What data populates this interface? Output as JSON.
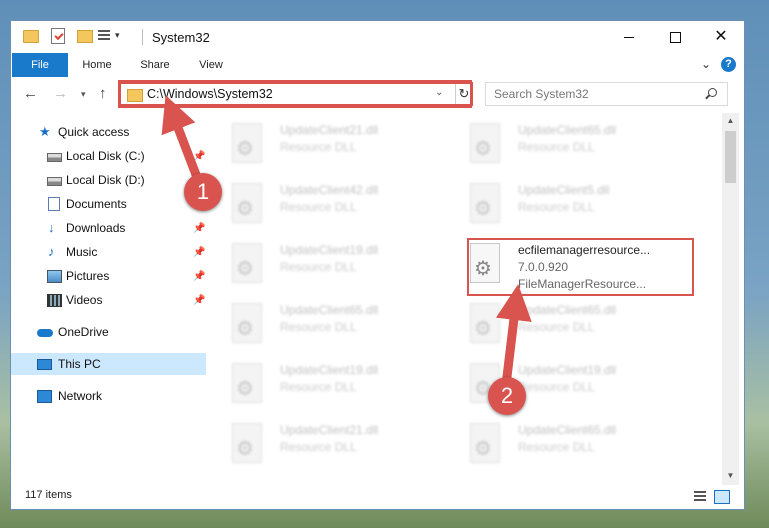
{
  "window": {
    "title": "System32"
  },
  "ribbon": {
    "tabs": [
      "File",
      "Home",
      "Share",
      "View"
    ]
  },
  "address": {
    "path": "C:\\Windows\\System32"
  },
  "search": {
    "placeholder": "Search System32"
  },
  "sidebar": {
    "items": [
      {
        "label": "Quick access",
        "icon": "star-icon",
        "pinned": false
      },
      {
        "label": "Local Disk (C:)",
        "icon": "drive-icon",
        "pinned": true
      },
      {
        "label": "Local Disk (D:)",
        "icon": "drive-icon",
        "pinned": false
      },
      {
        "label": "Documents",
        "icon": "documents-icon",
        "pinned": true
      },
      {
        "label": "Downloads",
        "icon": "download-icon",
        "pinned": true
      },
      {
        "label": "Music",
        "icon": "music-icon",
        "pinned": true
      },
      {
        "label": "Pictures",
        "icon": "pictures-icon",
        "pinned": true
      },
      {
        "label": "Videos",
        "icon": "videos-icon",
        "pinned": true
      },
      {
        "label": "OneDrive",
        "icon": "onedrive-icon",
        "pinned": false
      },
      {
        "label": "This PC",
        "icon": "pc-icon",
        "pinned": false,
        "selected": true
      },
      {
        "label": "Network",
        "icon": "network-icon",
        "pinned": false
      }
    ]
  },
  "files": [
    {
      "name": "UpdateClient21.dll",
      "type": "Resource DLL"
    },
    {
      "name": "UpdateClient65.dll",
      "type": "Resource DLL"
    },
    {
      "name": "UpdateClient42.dll",
      "type": "Resource DLL"
    },
    {
      "name": "UpdateClient5.dll",
      "type": "Resource DLL"
    },
    {
      "name": "UpdateClient19.dll",
      "type": "Resource DLL"
    },
    {
      "name": "ecfilemanagerresource...",
      "version": "7.0.0.920",
      "description": "FileManagerResource...",
      "highlighted": true
    },
    {
      "name": "UpdateClient65.dll",
      "type": "Resource DLL"
    },
    {
      "name": "UpdateClient65.dll",
      "type": "Resource DLL"
    },
    {
      "name": "UpdateClient19.dll",
      "type": "Resource DLL"
    },
    {
      "name": "UpdateClient19.dll",
      "type": "Resource DLL"
    },
    {
      "name": "UpdateClient21.dll",
      "type": "Resource DLL"
    },
    {
      "name": "UpdateClient65.dll",
      "type": "Resource DLL"
    }
  ],
  "status": {
    "item_count": "117 items"
  },
  "annotations": {
    "step1": "1",
    "step2": "2",
    "color": "#d9534f"
  }
}
